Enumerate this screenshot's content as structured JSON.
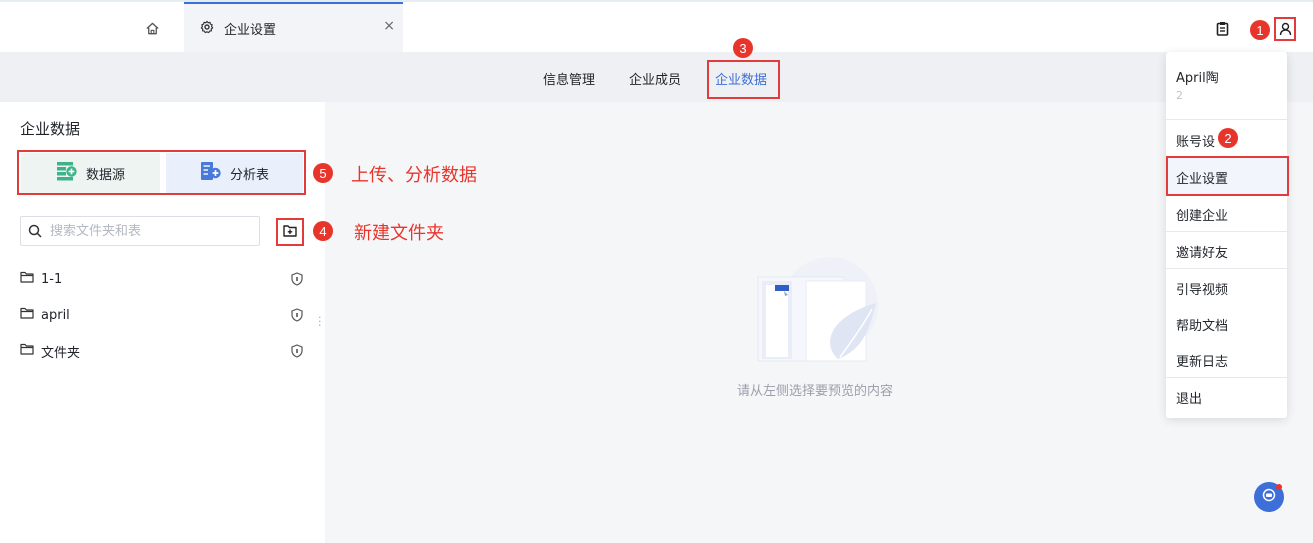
{
  "tabs": {
    "home_icon": "home-icon",
    "active_tab": {
      "icon": "gear-icon",
      "label": "企业设置",
      "close": "×"
    }
  },
  "header": {
    "clipboard_icon": "clipboard-icon",
    "user_icon": "user-icon"
  },
  "subnav": {
    "items": [
      {
        "label": "信息管理"
      },
      {
        "label": "企业成员"
      },
      {
        "label": "企业数据",
        "active": true
      }
    ]
  },
  "sidebar": {
    "title": "企业数据",
    "buttons": [
      {
        "label": "数据源",
        "icon": "datasource-add-icon"
      },
      {
        "label": "分析表",
        "icon": "analysis-add-icon"
      }
    ],
    "search_placeholder": "搜索文件夹和表",
    "folders": [
      {
        "label": "1-1"
      },
      {
        "label": "april"
      },
      {
        "label": "文件夹"
      }
    ]
  },
  "annotations": {
    "badges": [
      "1",
      "2",
      "3",
      "4",
      "5"
    ],
    "upload_note": "上传、分析数据",
    "new_folder_note": "新建文件夹"
  },
  "main": {
    "empty_text": "请从左侧选择要预览的内容"
  },
  "dropdown": {
    "user_name": "April陶",
    "user_sub": "2",
    "items": [
      {
        "label": "账号设"
      },
      {
        "label": "企业设置",
        "active": true
      },
      {
        "label": "创建企业"
      },
      {
        "label": "邀请好友"
      },
      {
        "label": "引导视频"
      },
      {
        "label": "帮助文档"
      },
      {
        "label": "更新日志"
      },
      {
        "label": "退出"
      }
    ]
  },
  "colors": {
    "accent": "#3d6fd8",
    "annotation_red": "#e8352c"
  }
}
